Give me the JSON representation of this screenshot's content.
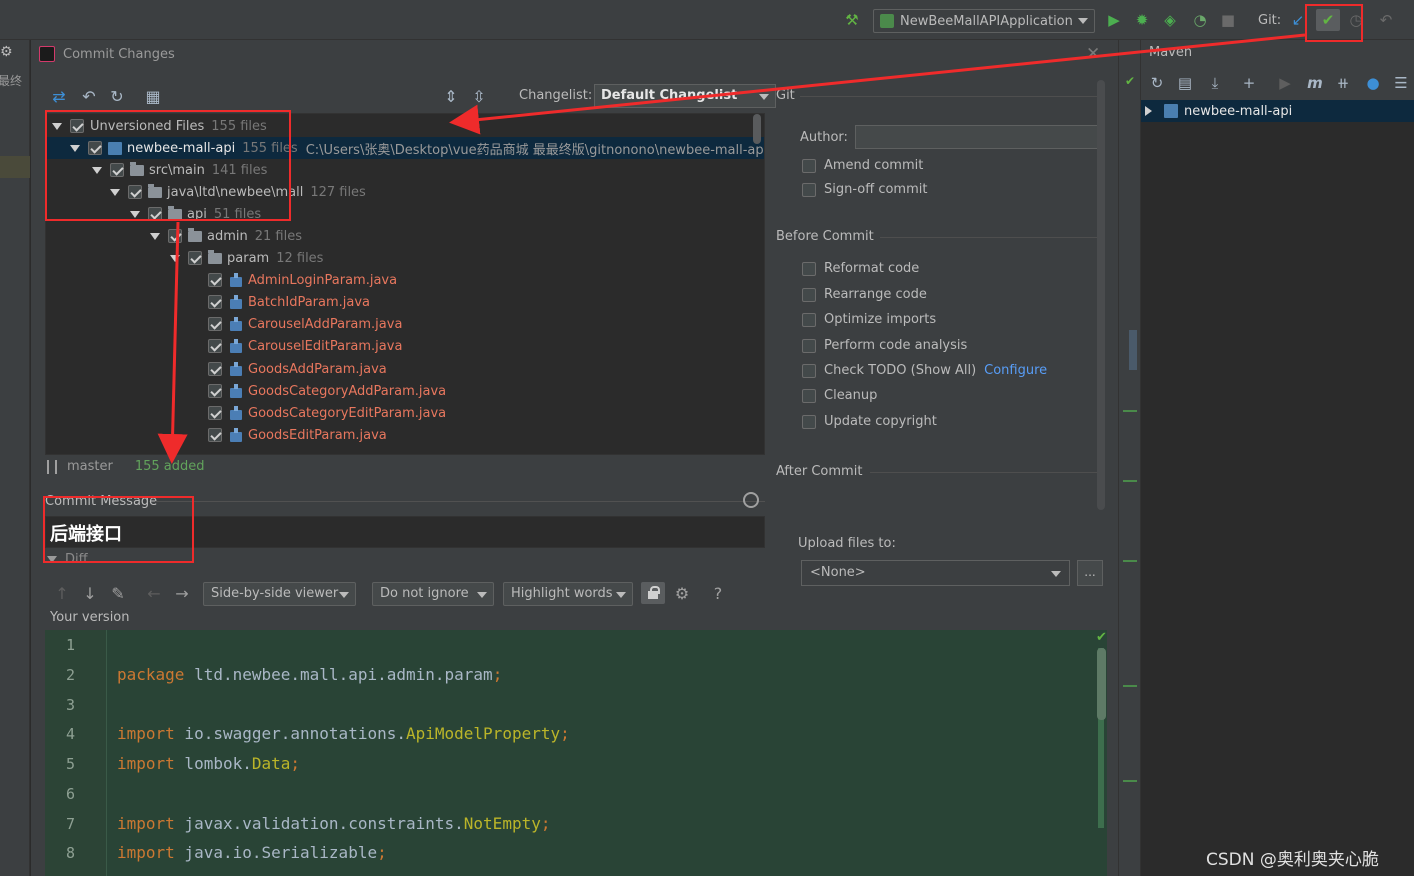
{
  "toolbar": {
    "run_config": "NewBeeMallAPIApplication",
    "git_label": "Git:"
  },
  "dialog": {
    "title": "Commit Changes",
    "changelist_label": "Changelist:",
    "changelist_value": "Default Changelist"
  },
  "tree": {
    "rows": [
      {
        "name": "Unversioned Files",
        "count": "155 files"
      },
      {
        "name": "newbee-mall-api",
        "count": "155 files",
        "path": "C:\\Users\\张奥\\Desktop\\vue药品商城 最最终版\\gitnonono\\newbee-mall-api"
      },
      {
        "name": "src\\main",
        "count": "141 files"
      },
      {
        "name": "java\\ltd\\newbee\\mall",
        "count": "127 files"
      },
      {
        "name": "api",
        "count": "51 files"
      },
      {
        "name": "admin",
        "count": "21 files"
      },
      {
        "name": "param",
        "count": "12 files"
      }
    ],
    "files": [
      "AdminLoginParam.java",
      "BatchIdParam.java",
      "CarouselAddParam.java",
      "CarouselEditParam.java",
      "GoodsAddParam.java",
      "GoodsCategoryAddParam.java",
      "GoodsCategoryEditParam.java",
      "GoodsEditParam.java"
    ]
  },
  "status": {
    "branch": "master",
    "added": "155 added"
  },
  "commit": {
    "label": "Commit Message",
    "message": "后端接口",
    "diff_label": "Diff"
  },
  "diff_toolbar": {
    "viewer": "Side-by-side viewer",
    "ignore": "Do not ignore",
    "highlight": "Highlight words",
    "help": "?"
  },
  "editor": {
    "your_version": "Your version",
    "line_numbers": [
      "1",
      "2",
      "3",
      "4",
      "5",
      "6",
      "7",
      "8"
    ],
    "lines": [
      {
        "kw": "",
        "text": "",
        "cls": "",
        "tail": ""
      },
      {
        "kw": "package",
        "text": " ltd.newbee.mall.api.admin.param",
        "cls": "",
        "tail": ";"
      },
      {
        "kw": "",
        "text": "",
        "cls": "",
        "tail": ""
      },
      {
        "kw": "import",
        "text": " io.swagger.annotations.",
        "cls": "ApiModelProperty",
        "tail": ";"
      },
      {
        "kw": "import",
        "text": " lombok.",
        "cls": "Data",
        "tail": ";"
      },
      {
        "kw": "",
        "text": "",
        "cls": "",
        "tail": ""
      },
      {
        "kw": "import",
        "text": " javax.validation.constraints.",
        "cls": "NotEmpty",
        "tail": ";"
      },
      {
        "kw": "import",
        "text": " java.io.Serializable",
        "cls": "",
        "tail": ";"
      }
    ]
  },
  "right": {
    "git_section": "Git",
    "author_label": "Author:",
    "amend": "Amend commit",
    "signoff": "Sign-off commit",
    "before_commit": "Before Commit",
    "options": [
      "Reformat code",
      "Rearrange code",
      "Optimize imports",
      "Perform code analysis",
      "Check TODO (Show All)",
      "Cleanup",
      "Update copyright"
    ],
    "configure_link": "Configure",
    "after_commit": "After Commit",
    "upload_label": "Upload files to:",
    "upload_value": "<None>",
    "browse": "..."
  },
  "maven": {
    "title": "Maven",
    "project": "newbee-mall-api"
  },
  "left_strip": {
    "partial_text": "最终"
  },
  "watermark": "CSDN @奥利奥夹心脆",
  "colors": {
    "accent_red": "#ef2b2b",
    "unversioned_file": "#e8775e",
    "added_green": "#62a35c",
    "link_blue": "#589df6"
  }
}
